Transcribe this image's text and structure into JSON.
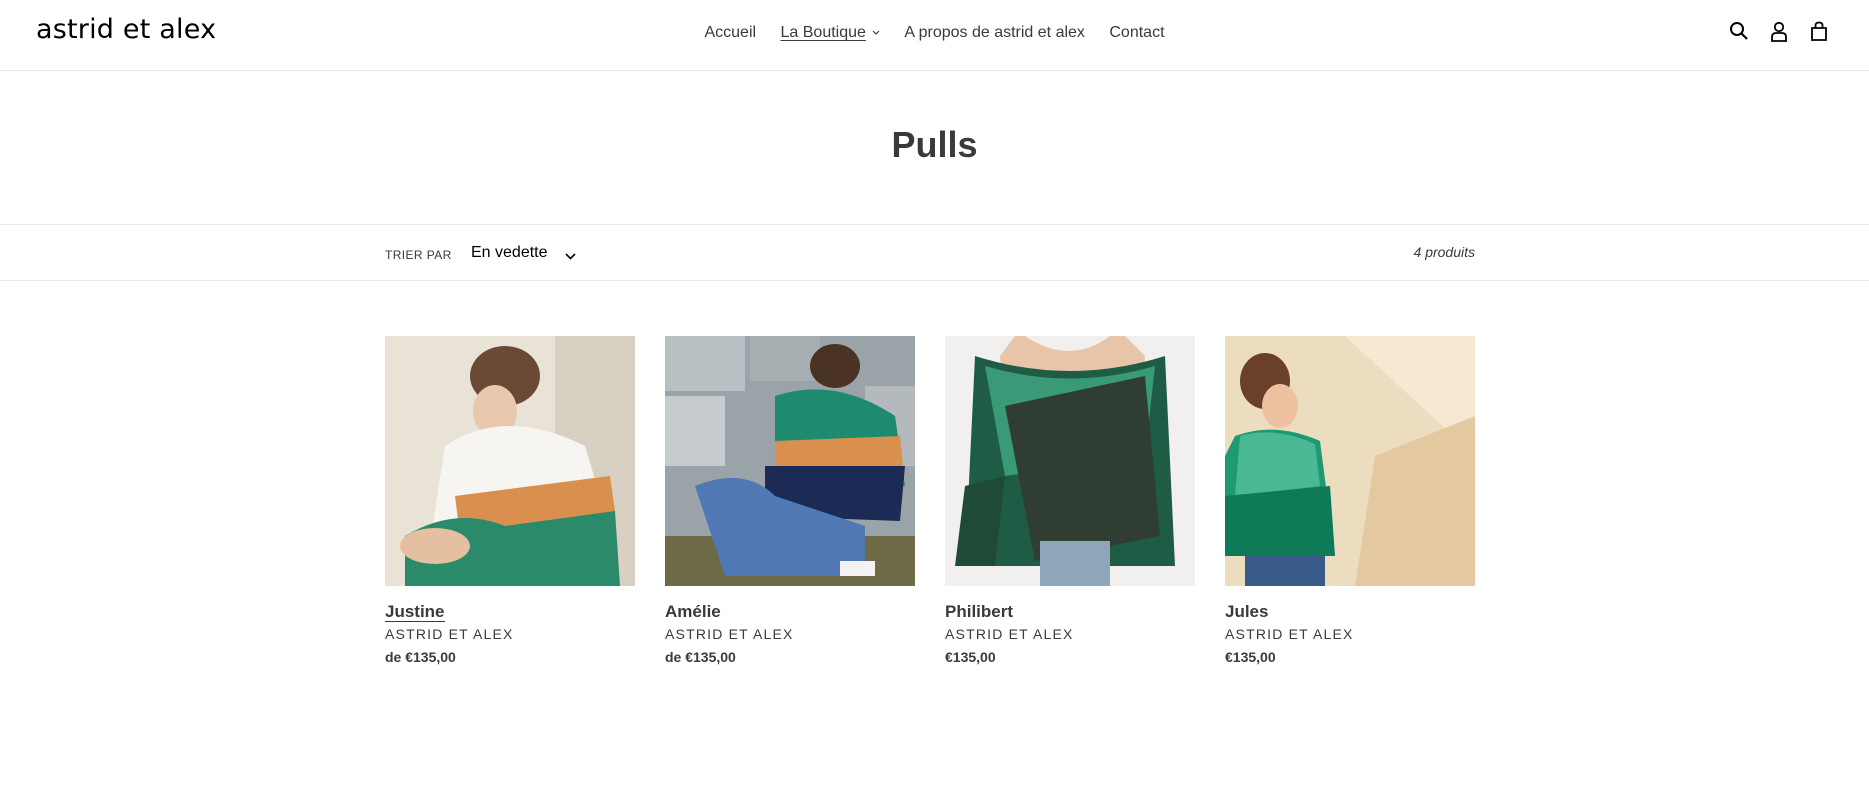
{
  "header": {
    "logo": "astrid et alex",
    "nav": [
      {
        "label": "Accueil"
      },
      {
        "label": "La Boutique"
      },
      {
        "label": "A propos de astrid et alex"
      },
      {
        "label": "Contact"
      }
    ],
    "icons": [
      "search-icon",
      "account-icon",
      "cart-icon"
    ]
  },
  "collection": {
    "title": "Pulls"
  },
  "filter": {
    "sort_label": "TRIER PAR",
    "sort_value": "En vedette",
    "count": "4 produits"
  },
  "products": [
    {
      "title": "Justine",
      "vendor": "ASTRID ET ALEX",
      "price": "de €135,00"
    },
    {
      "title": "Amélie",
      "vendor": "ASTRID ET ALEX",
      "price": "de €135,00"
    },
    {
      "title": "Philibert",
      "vendor": "ASTRID ET ALEX",
      "price": "€135,00"
    },
    {
      "title": "Jules",
      "vendor": "ASTRID ET ALEX",
      "price": "€135,00"
    }
  ],
  "colors": {
    "text": "#3a3a3a",
    "border": "#e8e9eb",
    "accent_green": "#1e7f5c",
    "accent_navy": "#1c2b55",
    "accent_orange": "#d9904e"
  }
}
